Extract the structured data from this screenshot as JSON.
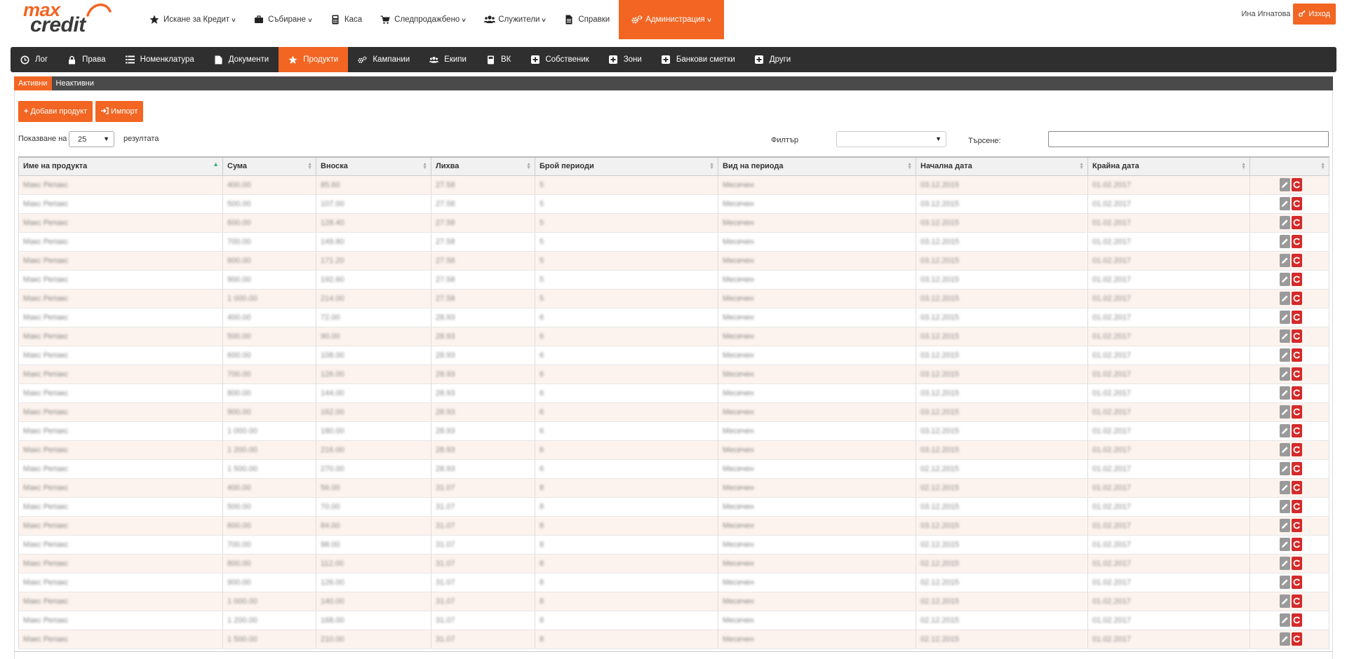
{
  "brand": {
    "logo_top": "max",
    "logo_bottom": "credit"
  },
  "main_nav": [
    {
      "icon": "star-icon",
      "label": "Искане за Кредит",
      "dropdown": true
    },
    {
      "icon": "briefcase-icon",
      "label": "Събиране",
      "dropdown": true
    },
    {
      "icon": "calculator-icon",
      "label": "Каса",
      "dropdown": false
    },
    {
      "icon": "cart-icon",
      "label": "Следпродажбено",
      "dropdown": true
    },
    {
      "icon": "users-icon",
      "label": "Служители",
      "dropdown": true
    },
    {
      "icon": "document-icon",
      "label": "Справки",
      "dropdown": false
    },
    {
      "icon": "cogs-icon",
      "label": "Администрация",
      "dropdown": true,
      "active": true
    }
  ],
  "user": {
    "name": "Ина Игнатова",
    "logout_label": "Изход"
  },
  "admin_nav": [
    {
      "icon": "clock-icon",
      "label": "Лог"
    },
    {
      "icon": "lock-icon",
      "label": "Права"
    },
    {
      "icon": "list-icon",
      "label": "Номенклатура"
    },
    {
      "icon": "document-icon",
      "label": "Документи"
    },
    {
      "icon": "star-icon",
      "label": "Продукти",
      "active": true
    },
    {
      "icon": "cogs-icon",
      "label": "Кампании"
    },
    {
      "icon": "users-icon",
      "label": "Екипи"
    },
    {
      "icon": "calculator-icon",
      "label": "ВК"
    },
    {
      "icon": "plus-square-icon",
      "label": "Собственик"
    },
    {
      "icon": "plus-square-icon",
      "label": "Зони"
    },
    {
      "icon": "plus-square-icon",
      "label": "Банкови сметки"
    },
    {
      "icon": "plus-square-icon",
      "label": "Други"
    }
  ],
  "sub_tabs": [
    {
      "label": "Активни",
      "active": true
    },
    {
      "label": "Неактивни"
    }
  ],
  "actions": {
    "add_label": "Добави продукт",
    "import_label": "Импорт"
  },
  "length": {
    "prefix": "Показване на",
    "value": "25",
    "suffix": "резултата"
  },
  "filter": {
    "label": "Филтър",
    "value": ""
  },
  "search": {
    "label": "Търсене:",
    "value": ""
  },
  "colors": {
    "accent": "#f26522",
    "dark_bar": "#2f2f2f",
    "sub_bar": "#4a4a4a",
    "delete": "#d42a2a"
  },
  "table": {
    "columns": [
      "Име на продукта",
      "Сума",
      "Вноска",
      "Лихва",
      "Брой периоди",
      "Вид на периода",
      "Начална дата",
      "Крайна дата",
      ""
    ],
    "sorted_column": 0,
    "rows": [
      [
        "Макс Репакс",
        "400.00",
        "85.60",
        "27.58",
        "5",
        "Месечен",
        "03.12.2015",
        "01.02.2017"
      ],
      [
        "Макс Репакс",
        "500.00",
        "107.00",
        "27.58",
        "5",
        "Месечен",
        "03.12.2015",
        "01.02.2017"
      ],
      [
        "Макс Репакс",
        "600.00",
        "128.40",
        "27.58",
        "5",
        "Месечен",
        "03.12.2015",
        "01.02.2017"
      ],
      [
        "Макс Репакс",
        "700.00",
        "149.80",
        "27.58",
        "5",
        "Месечен",
        "03.12.2015",
        "01.02.2017"
      ],
      [
        "Макс Репакс",
        "800.00",
        "171.20",
        "27.58",
        "5",
        "Месечен",
        "03.12.2015",
        "01.02.2017"
      ],
      [
        "Макс Репакс",
        "900.00",
        "192.60",
        "27.58",
        "5",
        "Месечен",
        "03.12.2015",
        "01.02.2017"
      ],
      [
        "Макс Репакс",
        "1 000.00",
        "214.00",
        "27.58",
        "5",
        "Месечен",
        "03.12.2015",
        "01.02.2017"
      ],
      [
        "Макс Репакс",
        "400.00",
        "72.00",
        "28.93",
        "6",
        "Месечен",
        "03.12.2015",
        "01.02.2017"
      ],
      [
        "Макс Репакс",
        "500.00",
        "90.00",
        "28.93",
        "6",
        "Месечен",
        "03.12.2015",
        "01.02.2017"
      ],
      [
        "Макс Репакс",
        "600.00",
        "108.00",
        "28.93",
        "6",
        "Месечен",
        "03.12.2015",
        "01.02.2017"
      ],
      [
        "Макс Репакс",
        "700.00",
        "126.00",
        "28.93",
        "6",
        "Месечен",
        "03.12.2015",
        "01.02.2017"
      ],
      [
        "Макс Репакс",
        "800.00",
        "144.00",
        "28.93",
        "6",
        "Месечен",
        "03.12.2015",
        "01.02.2017"
      ],
      [
        "Макс Репакс",
        "900.00",
        "162.00",
        "28.93",
        "6",
        "Месечен",
        "03.12.2015",
        "01.02.2017"
      ],
      [
        "Макс Репакс",
        "1 000.00",
        "180.00",
        "28.93",
        "6",
        "Месечен",
        "03.12.2015",
        "01.02.2017"
      ],
      [
        "Макс Репакс",
        "1 200.00",
        "216.00",
        "28.93",
        "6",
        "Месечен",
        "03.12.2015",
        "01.02.2017"
      ],
      [
        "Макс Репакс",
        "1 500.00",
        "270.00",
        "28.93",
        "6",
        "Месечен",
        "02.12.2015",
        "01.02.2017"
      ],
      [
        "Макс Репакс",
        "400.00",
        "56.00",
        "31.07",
        "8",
        "Месечен",
        "02.12.2015",
        "01.02.2017"
      ],
      [
        "Макс Репакс",
        "500.00",
        "70.00",
        "31.07",
        "8",
        "Месечен",
        "03.12.2015",
        "01.02.2017"
      ],
      [
        "Макс Репакс",
        "600.00",
        "84.00",
        "31.07",
        "8",
        "Месечен",
        "03.12.2015",
        "01.02.2017"
      ],
      [
        "Макс Репакс",
        "700.00",
        "98.00",
        "31.07",
        "8",
        "Месечен",
        "02.12.2015",
        "01.02.2017"
      ],
      [
        "Макс Репакс",
        "800.00",
        "112.00",
        "31.07",
        "8",
        "Месечен",
        "02.12.2015",
        "01.02.2017"
      ],
      [
        "Макс Репакс",
        "900.00",
        "126.00",
        "31.07",
        "8",
        "Месечен",
        "02.12.2015",
        "01.02.2017"
      ],
      [
        "Макс Репакс",
        "1 000.00",
        "140.00",
        "31.07",
        "8",
        "Месечен",
        "02.12.2015",
        "01.02.2017"
      ],
      [
        "Макс Репакс",
        "1 200.00",
        "168.00",
        "31.07",
        "8",
        "Месечен",
        "02.12.2015",
        "01.02.2017"
      ],
      [
        "Макс Репакс",
        "1 500.00",
        "210.00",
        "31.07",
        "8",
        "Месечен",
        "02.12.2015",
        "01.02.2017"
      ]
    ]
  }
}
